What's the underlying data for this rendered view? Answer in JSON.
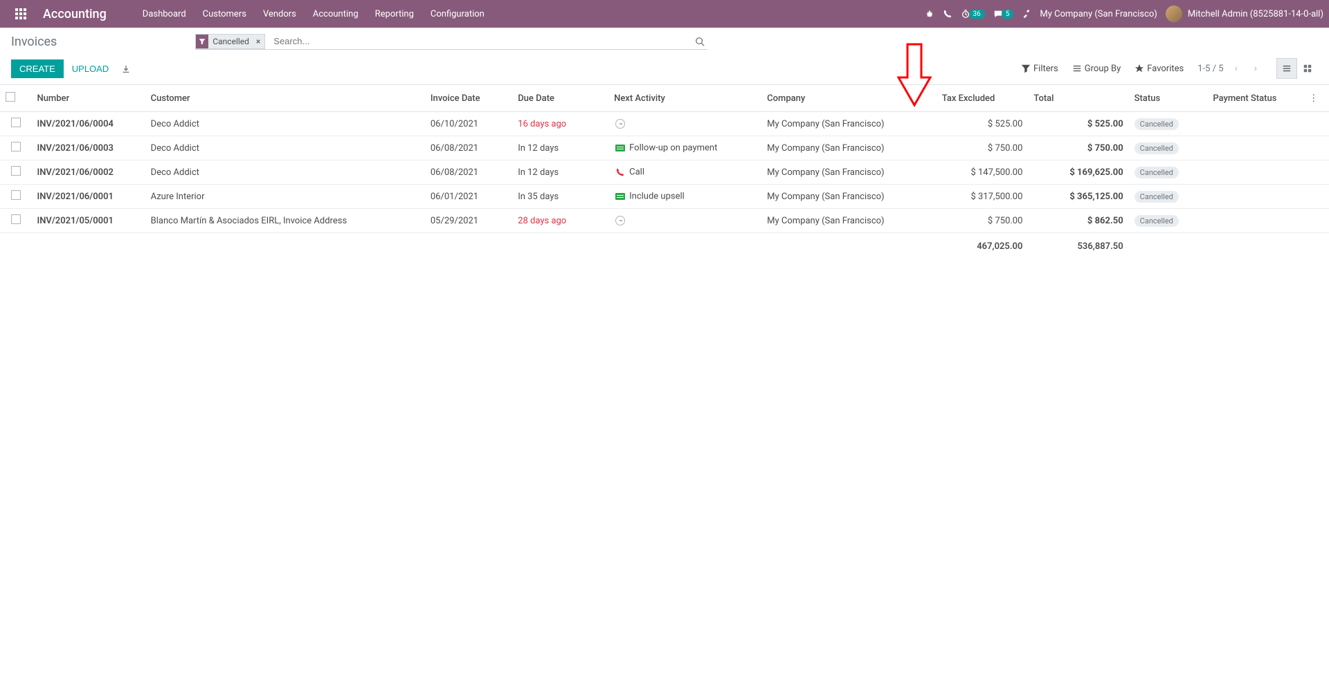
{
  "navbar": {
    "app_name": "Accounting",
    "menu": [
      "Dashboard",
      "Customers",
      "Vendors",
      "Accounting",
      "Reporting",
      "Configuration"
    ],
    "timer_badge": "36",
    "chat_badge": "5",
    "company": "My Company (San Francisco)",
    "user": "Mitchell Admin (8525881-14-0-all)"
  },
  "breadcrumb": "Invoices",
  "search": {
    "filter_label": "Cancelled",
    "placeholder": "Search..."
  },
  "buttons": {
    "create": "Create",
    "upload": "Upload"
  },
  "search_options": {
    "filters": "Filters",
    "group_by": "Group By",
    "favorites": "Favorites"
  },
  "pager": "1-5 / 5",
  "columns": {
    "number": "Number",
    "customer": "Customer",
    "invoice_date": "Invoice Date",
    "due_date": "Due Date",
    "next_activity": "Next Activity",
    "company": "Company",
    "tax_excluded": "Tax Excluded",
    "total": "Total",
    "status": "Status",
    "payment_status": "Payment Status"
  },
  "rows": [
    {
      "number": "INV/2021/06/0004",
      "customer": "Deco Addict",
      "invoice_date": "06/10/2021",
      "due_date": "16 days ago",
      "due_overdue": true,
      "activity_icon": "clock",
      "activity": "",
      "company": "My Company (San Francisco)",
      "tax_excluded": "$ 525.00",
      "total": "$ 525.00",
      "status": "Cancelled"
    },
    {
      "number": "INV/2021/06/0003",
      "customer": "Deco Addict",
      "invoice_date": "06/08/2021",
      "due_date": "In 12 days",
      "due_overdue": false,
      "activity_icon": "doc",
      "activity": "Follow-up on payment",
      "company": "My Company (San Francisco)",
      "tax_excluded": "$ 750.00",
      "total": "$ 750.00",
      "status": "Cancelled"
    },
    {
      "number": "INV/2021/06/0002",
      "customer": "Deco Addict",
      "invoice_date": "06/08/2021",
      "due_date": "In 12 days",
      "due_overdue": false,
      "activity_icon": "phone",
      "activity": "Call",
      "company": "My Company (San Francisco)",
      "tax_excluded": "$ 147,500.00",
      "total": "$ 169,625.00",
      "status": "Cancelled"
    },
    {
      "number": "INV/2021/06/0001",
      "customer": "Azure Interior",
      "invoice_date": "06/01/2021",
      "due_date": "In 35 days",
      "due_overdue": false,
      "activity_icon": "doc",
      "activity": "Include upsell",
      "company": "My Company (San Francisco)",
      "tax_excluded": "$ 317,500.00",
      "total": "$ 365,125.00",
      "status": "Cancelled"
    },
    {
      "number": "INV/2021/05/0001",
      "customer": "Blanco Martín & Asociados EIRL, Invoice Address",
      "invoice_date": "05/29/2021",
      "due_date": "28 days ago",
      "due_overdue": true,
      "activity_icon": "clock",
      "activity": "",
      "company": "My Company (San Francisco)",
      "tax_excluded": "$ 750.00",
      "total": "$ 862.50",
      "status": "Cancelled"
    }
  ],
  "totals": {
    "tax_excluded": "467,025.00",
    "total": "536,887.50"
  }
}
